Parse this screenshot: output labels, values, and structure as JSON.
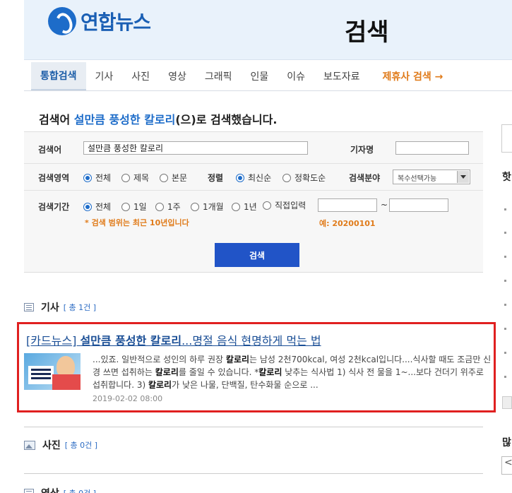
{
  "header": {
    "logo_text": "연합뉴스",
    "page_title": "검색"
  },
  "nav": {
    "items": [
      {
        "label": "통합검색"
      },
      {
        "label": "기사"
      },
      {
        "label": "사진"
      },
      {
        "label": "영상"
      },
      {
        "label": "그래픽"
      },
      {
        "label": "인물"
      },
      {
        "label": "이슈"
      },
      {
        "label": "보도자료"
      }
    ],
    "partner_label": "제휴사 검색 →"
  },
  "summary": {
    "prefix": "검색어 ",
    "keyword": "설만큼 풍성한 칼로리",
    "suffix": "(으)로 검색했습니다."
  },
  "form": {
    "keyword_label": "검색어",
    "keyword_value": "설만큼 풍성한 칼로리",
    "reporter_label": "기자명",
    "reporter_value": "",
    "area_label": "검색영역",
    "area_options": [
      "전체",
      "제목",
      "본문"
    ],
    "sort_label": "정렬",
    "sort_options": [
      "최신순",
      "정확도순"
    ],
    "field_label": "검색분야",
    "field_value": "복수선택가능",
    "period_label": "검색기간",
    "period_options": [
      "전체",
      "1일",
      "1주",
      "1개월",
      "1년",
      "직접입력"
    ],
    "range_separator": "~",
    "range_note": "* 검색 범위는 최근 10년입니다",
    "example_note": "예: 20200101",
    "search_button": "검색"
  },
  "results": {
    "articles": {
      "title": "기사",
      "count": "[ 총 1건 ]",
      "items": [
        {
          "title_prefix": "[카드뉴스] ",
          "title_hl": "설만큼 풍성한 칼로리",
          "title_rest": "...명절 음식 현명하게 먹는 법",
          "snippet_1": "...있죠. 일반적으로 성인의 하루 권장 ",
          "snippet_2": "는 남성 2천700kcal, 여성 2천kcal입니다....식사할 때도 조금만 신경 쓰면 섭취하는 ",
          "snippet_3": "를 줄일 수 있습니다. *",
          "snippet_4": " 낮추는 식사법 1) 식사 전 물을 1~...보다 건더기 위주로 섭취합니다. 3) ",
          "snippet_5": "가 낮은 나물, 단백질, 탄수화물 순으로 ...",
          "keyword": "칼로리",
          "date": "2019-02-02 08:00"
        }
      ]
    },
    "photos": {
      "title": "사진",
      "count": "[ 총 0건 ]"
    },
    "videos": {
      "title": "영상",
      "count": "[ 총 0건 ]"
    }
  },
  "sidebar": {
    "heading_partial": "핫",
    "many_partial": "많",
    "prev_glyph": "<"
  },
  "colors": {
    "accent": "#1d6cc9",
    "button": "#2154c7",
    "highlight_box": "#e02020",
    "partner": "#e07b1a"
  }
}
